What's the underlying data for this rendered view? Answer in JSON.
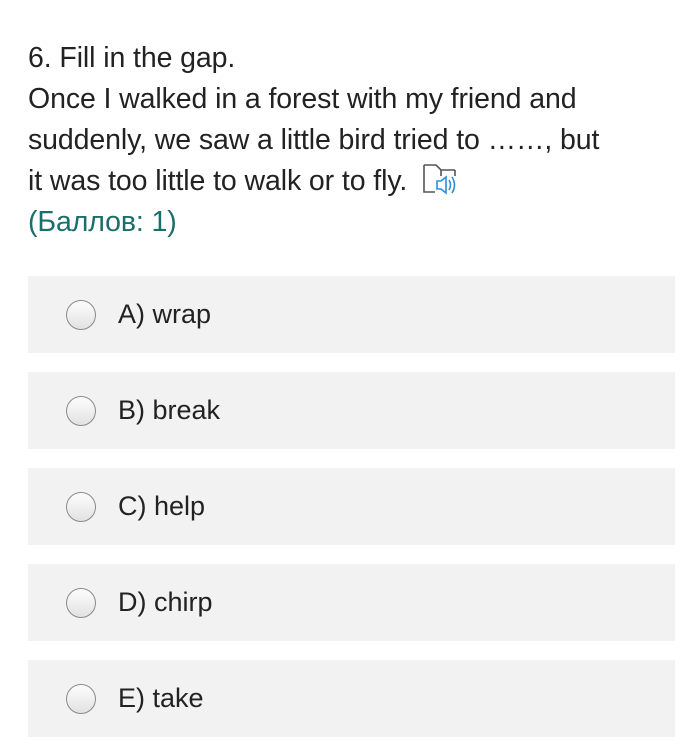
{
  "question": {
    "title": "6. Fill in the gap.",
    "lines": [
      "Once I walked in a forest with my friend and",
      "suddenly, we saw a little bird tried to ……, but",
      "it was too little to walk or to fly."
    ],
    "audio_icon": "read-aloud-icon",
    "points": "(Баллов: 1)"
  },
  "options": [
    {
      "label": "A) wrap"
    },
    {
      "label": "B) break"
    },
    {
      "label": "C) help"
    },
    {
      "label": "D) chirp"
    },
    {
      "label": "E) take"
    }
  ],
  "colors": {
    "points_text": "#1b6e6b",
    "option_background": "#f2f2f2",
    "audio_icon": "#2b8fd6"
  }
}
